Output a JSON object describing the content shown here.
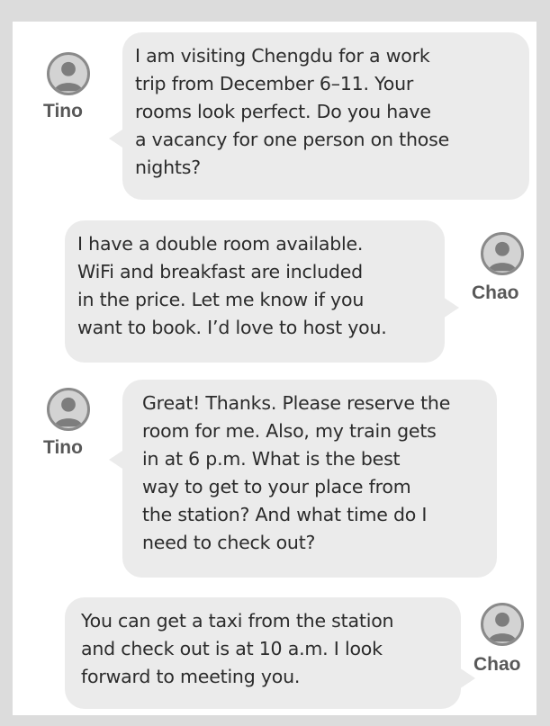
{
  "conversation": {
    "messages": [
      {
        "sender": "Tino",
        "side": "left",
        "avatar_icon": "person-icon",
        "lines": [
          "I am visiting Chengdu for a work",
          "trip from December 6–11. Your",
          "rooms look perfect. Do you have",
          "a vacancy for one person on those",
          "nights?"
        ]
      },
      {
        "sender": "Chao",
        "side": "right",
        "avatar_icon": "person-icon",
        "lines": [
          "I have a double room available.",
          "WiFi and breakfast are included",
          "in the price. Let me know if you",
          "want to book. I’d love to host you."
        ]
      },
      {
        "sender": "Tino",
        "side": "left",
        "avatar_icon": "person-icon",
        "lines": [
          "Great! Thanks. Please reserve the",
          "room for me. Also, my train gets",
          "in at 6 p.m. What is the best",
          "way to get to your place from",
          "the station? And what time do I",
          "need to check out?"
        ]
      },
      {
        "sender": "Chao",
        "side": "right",
        "avatar_icon": "person-icon",
        "lines": [
          "You can get a taxi from the station",
          "and check out is at 10 a.m. I look",
          "forward to meeting you."
        ]
      }
    ]
  },
  "colors": {
    "frame": "#dcdcdc",
    "bubble": "#ebebeb",
    "text": "#2b2b2b",
    "name": "#585858",
    "avatar_ring": "#8a8a8a",
    "avatar_fill": "#d3d3d3"
  }
}
